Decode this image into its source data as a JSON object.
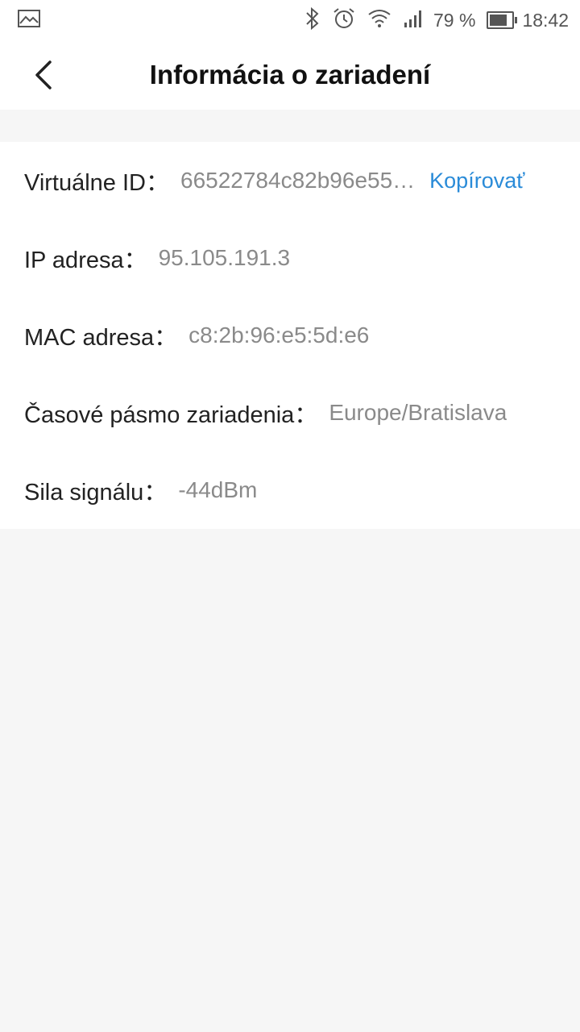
{
  "status_bar": {
    "battery_percent_label": "79 %",
    "battery_level": 0.79,
    "time": "18:42",
    "icons": [
      "image-icon",
      "bluetooth-icon",
      "alarm-icon",
      "wifi-icon",
      "signal-icon",
      "battery-icon"
    ]
  },
  "header": {
    "title": "Informácia o zariadení",
    "back_icon": "chevron-left-icon"
  },
  "info": {
    "virtual_id": {
      "label": "Virtuálne ID：",
      "value": "66522784c82b96e55…",
      "action": "Kopírovať"
    },
    "ip": {
      "label": "IP adresa：",
      "value": "95.105.191.3"
    },
    "mac": {
      "label": "MAC adresa：",
      "value": "c8:2b:96:e5:5d:e6"
    },
    "timezone": {
      "label": "Časové pásmo zariadenia：",
      "value": "Europe/Bratislava"
    },
    "signal": {
      "label": "Sila signálu：",
      "value": "-44dBm"
    }
  },
  "colors": {
    "accent": "#2a8bd8",
    "background": "#f6f6f6",
    "card": "#ffffff",
    "label": "#222222",
    "value": "#8a8a8a"
  }
}
